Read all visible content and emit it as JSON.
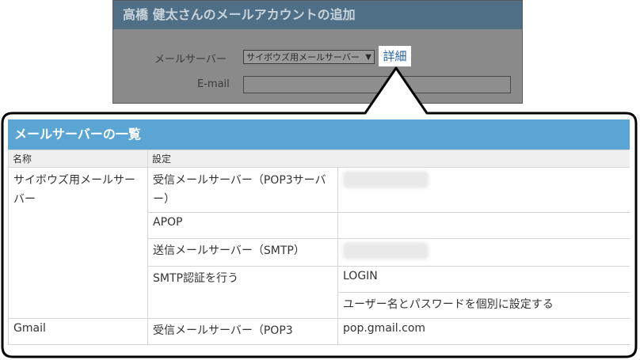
{
  "background_dialog": {
    "title": "高橋 健太さんのメールアカウントの追加",
    "mail_server_label": "メールサーバー",
    "mail_server_selected": "サイボウズ用メールサーバー",
    "detail_link": "詳細",
    "email_label": "E-mail",
    "email_value": ""
  },
  "server_list": {
    "title": "メールサーバーの一覧",
    "columns": [
      "名称",
      "設定"
    ],
    "rows": [
      {
        "name": "サイボウズ用メールサーバー",
        "setting": "受信メールサーバー（POP3サーバー）",
        "value": ""
      },
      {
        "name": "",
        "setting": "APOP",
        "value": ""
      },
      {
        "name": "",
        "setting": "送信メールサーバー（SMTP）",
        "value": ""
      },
      {
        "name": "",
        "setting": "SMTP認証を行う",
        "value": "LOGIN"
      },
      {
        "name": "",
        "setting": "",
        "value": "ユーザー名とパスワードを個別に設定する"
      },
      {
        "name": "Gmail",
        "setting": "受信メールサーバー（POP3",
        "value": "pop.gmail.com"
      }
    ]
  },
  "colors": {
    "header_blue": "#5aa5d4",
    "link_blue": "#2563a8",
    "dim_title": "#4f6f86"
  }
}
